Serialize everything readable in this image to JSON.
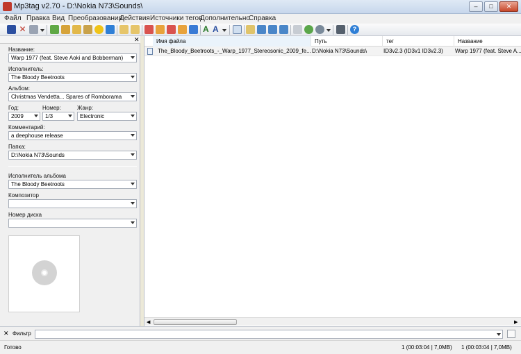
{
  "window": {
    "title": "Mp3tag v2.70  -  D:\\Nokia N73\\Sounds\\",
    "minimize": "–",
    "maximize": "□",
    "close": "✕"
  },
  "menu": [
    "Файл",
    "Правка",
    "Вид",
    "Преобразования",
    "Действия",
    "Источники тегов",
    "Дополнительно",
    "Справка"
  ],
  "toolbar": {
    "icons": [
      "save-icon",
      "delete-icon",
      "undo-icon",
      "open-folder-icon",
      "add-folder-icon",
      "save-playlist-icon",
      "export-icon",
      "tag-sources-icon",
      "favorite-icon",
      "refresh-icon",
      "convert-tag-filename-icon",
      "convert-filename-tag-icon",
      "convert-tag-tag-icon",
      "auto-numbering-icon",
      "case-conversion-icon",
      "text-format-icon",
      "options-icon",
      "extended-tags-icon",
      "filter-icon",
      "web-icon",
      "tools-icon",
      "help-icon"
    ]
  },
  "panel": {
    "close": "✕",
    "fields": {
      "title_label": "Название:",
      "title_value": "Warp 1977 (feat. Steve Aoki and Bobberman)",
      "artist_label": "Исполнитель:",
      "artist_value": "The Bloody Beetroots",
      "album_label": "Альбом:",
      "album_value": "Christmas Vendetta... Spares of Romborama",
      "year_label": "Год:",
      "year_value": "2009",
      "track_label": "Номер:",
      "track_value": "1/3",
      "genre_label": "Жанр:",
      "genre_value": "Electronic",
      "comment_label": "Комментарий:",
      "comment_value": "a deephouse release",
      "folder_label": "Папка:",
      "folder_value": "D:\\Nokia N73\\Sounds",
      "album_artist_label": "Исполнитель альбома",
      "album_artist_value": "The Bloody Beetroots",
      "composer_label": "Композитор",
      "composer_value": "",
      "disc_label": "Номер диска",
      "disc_value": ""
    }
  },
  "filelist": {
    "columns": [
      "Имя файла",
      "Путь",
      "тег",
      "Название"
    ],
    "rows": [
      {
        "filename": "The_Bloody_Beetroots_-_Warp_1977_Stereosonic_2009_fe...",
        "path": "D:\\Nokia N73\\Sounds\\",
        "tag": "ID3v2.3 (ID3v1 ID3v2.3)",
        "title": "Warp 1977 (feat. Steve A..."
      }
    ]
  },
  "filter": {
    "label": "Фильтр",
    "close": "✕",
    "value": ""
  },
  "status": {
    "left": "Готово",
    "selected": "1 (00:03:04 | 7,0MB)",
    "total": "1 (00:03:04 | 7,0MB)"
  }
}
